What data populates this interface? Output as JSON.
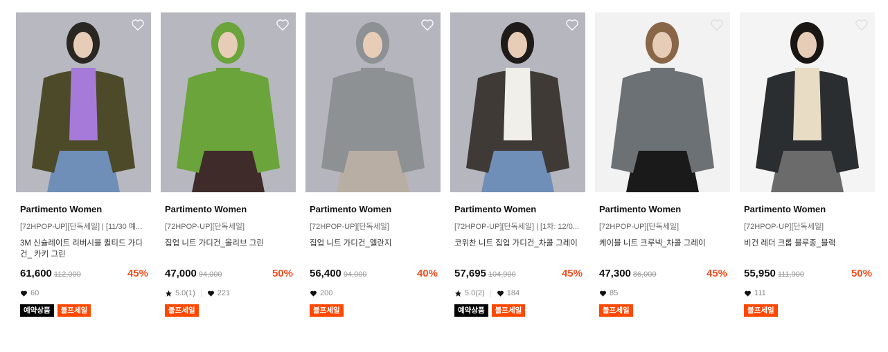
{
  "colors": {
    "accent": "#f24e1e",
    "sale_tag": "#ff4800",
    "reserve_tag": "#000000"
  },
  "products": [
    {
      "brand": "Partimento Women",
      "sub": "[72HPOP-UP][단독세일] | [11/30 예...",
      "name": "3M 신슐레이트 리버시블 퀼티드 가디건_ 카키 그린",
      "price": "61,600",
      "original_price": "112,000",
      "discount": "45%",
      "rating": "",
      "likes": "60",
      "tags": [
        "예약상품",
        "블프세일"
      ],
      "art": {
        "bg": "#b7b8c0",
        "top": "#4d4a2a",
        "inner": "#a67ad8",
        "bottom": "#6f8fb8",
        "hair": "#2a2622"
      }
    },
    {
      "brand": "Partimento Women",
      "sub": "[72HPOP-UP][단독세일]",
      "name": "집업 니트 가디건_올리브 그린",
      "price": "47,000",
      "original_price": "94,000",
      "discount": "50%",
      "rating": "5.0(1)",
      "likes": "221",
      "tags": [
        "블프세일"
      ],
      "art": {
        "bg": "#b6b7bf",
        "top": "#6aa43a",
        "inner": "#6aa43a",
        "bottom": "#3e2b2a",
        "hair": "#6aa43a"
      }
    },
    {
      "brand": "Partimento Women",
      "sub": "[72HPOP-UP][단독세일]",
      "name": "집업 니트 가디건_멜란지",
      "price": "56,400",
      "original_price": "94,000",
      "discount": "40%",
      "rating": "",
      "likes": "200",
      "tags": [
        "블프세일"
      ],
      "art": {
        "bg": "#b4b5bd",
        "top": "#8d9193",
        "inner": "#8d9193",
        "bottom": "#b9aea3",
        "hair": "#8d9193"
      }
    },
    {
      "brand": "Partimento Women",
      "sub": "[72HPOP-UP][단독세일] | [1차: 12/0...",
      "name": "코위찬 니트 집업 가디건_차콜 그레이",
      "price": "57,695",
      "original_price": "104,900",
      "discount": "45%",
      "rating": "5.0(2)",
      "likes": "184",
      "tags": [
        "예약상품",
        "블프세일"
      ],
      "art": {
        "bg": "#b5b6be",
        "top": "#3f3a36",
        "inner": "#f0efe9",
        "bottom": "#6f8fb8",
        "hair": "#1f1b18"
      }
    },
    {
      "brand": "Partimento Women",
      "sub": "[72HPOP-UP][단독세일]",
      "name": "케이블 니트 크루넥_차콜 그레이",
      "price": "47,300",
      "original_price": "86,000",
      "discount": "45%",
      "rating": "",
      "likes": "85",
      "tags": [
        "블프세일"
      ],
      "art": {
        "bg": "#f2f2f2",
        "top": "#6c7175",
        "inner": "#6c7175",
        "bottom": "#1a1a1a",
        "hair": "#8a6648"
      }
    },
    {
      "brand": "Partimento Women",
      "sub": "[72HPOP-UP][단독세일]",
      "name": "비건 레더 크롭 블루종_블랙",
      "price": "55,950",
      "original_price": "111,900",
      "discount": "50%",
      "rating": "",
      "likes": "111",
      "tags": [
        "블프세일"
      ],
      "art": {
        "bg": "#f4f4f4",
        "top": "#2b2e31",
        "inner": "#e8dcc4",
        "bottom": "#6b6b6b",
        "hair": "#1a1614"
      }
    }
  ]
}
